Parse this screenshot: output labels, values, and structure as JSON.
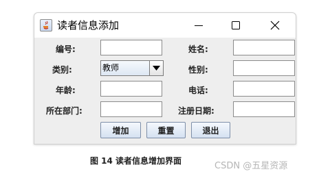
{
  "window": {
    "title": "读者信息添加"
  },
  "form": {
    "id_label": "编号:",
    "name_label": "姓名:",
    "category_label": "类别:",
    "category_value": "教师",
    "gender_label": "性别:",
    "age_label": "年龄:",
    "phone_label": "电话:",
    "dept_label": "所在部门:",
    "regdate_label": "注册日期:"
  },
  "buttons": {
    "add": "增加",
    "reset": "重置",
    "exit": "退出"
  },
  "caption": "图 14  读者信息增加界面",
  "watermark": "CSDN @五星资源"
}
